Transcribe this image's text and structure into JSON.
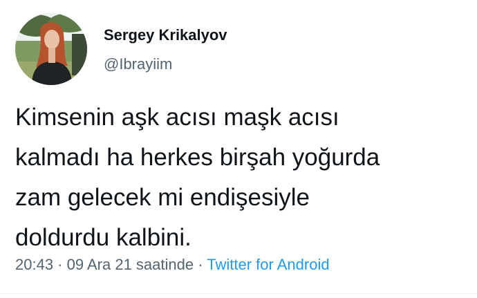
{
  "author": {
    "display_name": "Sergey Krikalyov",
    "handle": "@Ibrayiim"
  },
  "tweet": {
    "lines": [
      "Kimsenin aşk acısı maşk acısı",
      "kalmadı ha herkes birşah yoğurda",
      "zam gelecek mi endişesiyle",
      "doldurdu kalbini."
    ]
  },
  "meta": {
    "time": "20:43",
    "separator": " · ",
    "date": "09 Ara 21 saatinde",
    "client": "Twitter for Android"
  },
  "colors": {
    "text": "#0f1419",
    "secondary": "#536471",
    "link": "#1d9bf0"
  }
}
